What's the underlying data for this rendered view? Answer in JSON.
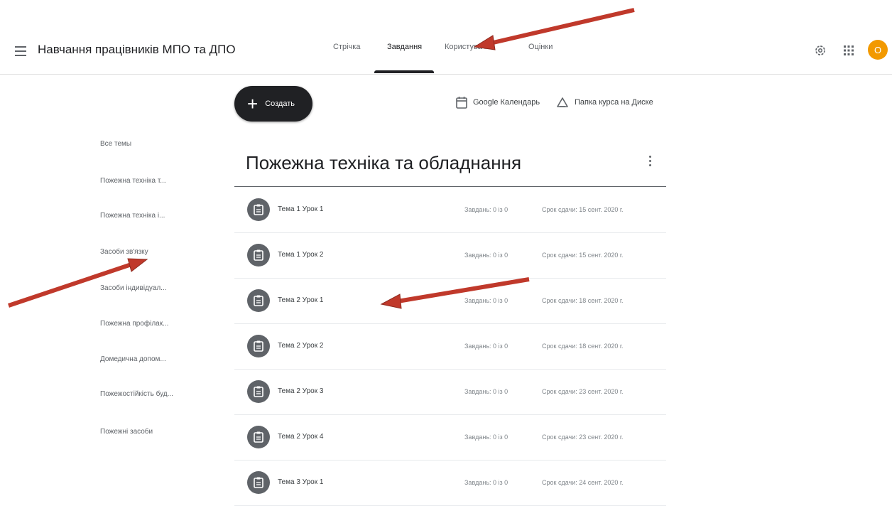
{
  "header": {
    "title": "Навчання працівників МПО та ДПО",
    "tabs": [
      {
        "label": "Стрічка"
      },
      {
        "label": "Завдання"
      },
      {
        "label": "Користувачі"
      },
      {
        "label": "Оцінки"
      }
    ],
    "active_tab_index": 1,
    "avatar_initial": "О"
  },
  "actions": {
    "create_label": "Создать",
    "calendar_label": "Google Календарь",
    "drive_label": "Папка курса на Диске"
  },
  "sidebar": {
    "items": [
      {
        "label": "Все темы"
      },
      {
        "label": "Пожежна техніка т..."
      },
      {
        "label": "Пожежна техніка і..."
      },
      {
        "label": "Засоби зв'язку"
      },
      {
        "label": "Засоби індивідуал..."
      },
      {
        "label": "Пожежна профілак..."
      },
      {
        "label": "Домедична допом..."
      },
      {
        "label": "Пожежостійкість буд..."
      },
      {
        "label": "Пожежні засоби"
      }
    ]
  },
  "topic": {
    "title": "Пожежна техніка та обладнання"
  },
  "assignments": [
    {
      "title": "Тема 1 Урок 1",
      "note": "Завдань: 0 із 0",
      "due": "Срок сдачи: 15 сент. 2020 г."
    },
    {
      "title": "Тема 1 Урок 2",
      "note": "Завдань: 0 із 0",
      "due": "Срок сдачи: 15 сент. 2020 г."
    },
    {
      "title": "Тема 2 Урок 1",
      "note": "Завдань: 0 із 0",
      "due": "Срок сдачи: 18 сент. 2020 г."
    },
    {
      "title": "Тема 2 Урок 2",
      "note": "Завдань: 0 із 0",
      "due": "Срок сдачи: 18 сент. 2020 г."
    },
    {
      "title": "Тема 2 Урок 3",
      "note": "Завдань: 0 із 0",
      "due": "Срок сдачи: 23 сент. 2020 г."
    },
    {
      "title": "Тема 2 Урок 4",
      "note": "Завдань: 0 із 0",
      "due": "Срок сдачи: 23 сент. 2020 г."
    },
    {
      "title": "Тема 3 Урок 1",
      "note": "Завдань: 0 із 0",
      "due": "Срок сдачи: 24 сент. 2020 г."
    }
  ],
  "colors": {
    "accent_dark": "#202124",
    "avatar": "#f29900",
    "annotation_arrow": "#c0392b"
  },
  "icons": [
    "menu-icon",
    "plus-icon",
    "calendar-icon",
    "drive-folder-icon",
    "settings-icon",
    "apps-grid-icon",
    "assignment-icon",
    "more-vert-icon"
  ]
}
